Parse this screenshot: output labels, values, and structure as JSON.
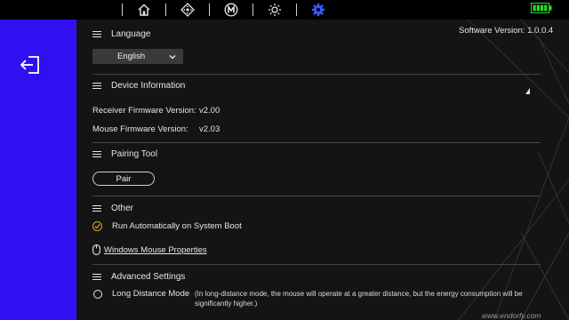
{
  "nav": {
    "items": [
      {
        "name": "home",
        "icon": "home-icon",
        "active": false
      },
      {
        "name": "dpad",
        "icon": "dpad-icon",
        "active": false
      },
      {
        "name": "macro",
        "icon": "macro-icon",
        "active": false
      },
      {
        "name": "lighting",
        "icon": "sun-icon",
        "active": false
      },
      {
        "name": "settings",
        "icon": "gear-icon",
        "active": true
      }
    ],
    "active_color": "#3a5bff",
    "battery_color": "#29d629"
  },
  "sidebar": {
    "color": "#3010f0",
    "back_icon": "back-arrow-icon"
  },
  "software_version": {
    "label": "Software Version:",
    "value": "1.0.0.4"
  },
  "language": {
    "title": "Language",
    "selected": "English"
  },
  "device_info": {
    "title": "Device Information",
    "receiver_label": "Receiver Firmware Version:",
    "receiver_value": "v2.00",
    "mouse_label": "Mouse Firmware Version:",
    "mouse_value": "v2.03"
  },
  "pairing": {
    "title": "Pairing Tool",
    "button_label": "Pair"
  },
  "other": {
    "title": "Other",
    "autostart_label": "Run Automatically on System Boot",
    "autostart_checked": true,
    "mouse_properties_label": "Windows Mouse Properties"
  },
  "advanced": {
    "title": "Advanced Settings",
    "long_distance_label": "Long Distance Mode",
    "long_distance_checked": false,
    "long_distance_note": "(In long-distance mode, the mouse will operate at a greater distance, but the energy consumption will be significantly higher.)"
  },
  "watermark": "www.endorfy.com"
}
